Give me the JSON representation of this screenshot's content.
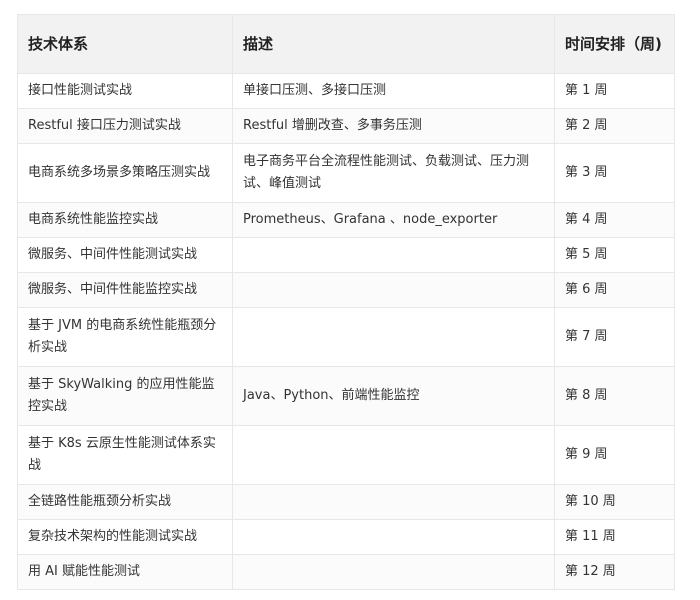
{
  "table": {
    "headers": {
      "col1": "技术体系",
      "col2": "描述",
      "col3": "时间安排（周)"
    },
    "rows": [
      {
        "system": "接口性能测试实战",
        "desc": "单接口压测、多接口压测",
        "week": "第 1 周"
      },
      {
        "system": "Restful 接口压力测试实战",
        "desc": "Restful 增删改查、多事务压测",
        "week": "第 2 周"
      },
      {
        "system": "电商系统多场景多策略压测实战",
        "desc": "电子商务平台全流程性能测试、负载测试、压力测试、峰值测试",
        "week": "第 3 周"
      },
      {
        "system": "电商系统性能监控实战",
        "desc": "Prometheus、Grafana 、node_exporter",
        "week": "第 4 周"
      },
      {
        "system": "微服务、中间件性能测试实战",
        "desc": "",
        "week": "第 5 周"
      },
      {
        "system": "微服务、中间件性能监控实战",
        "desc": "",
        "week": "第 6 周"
      },
      {
        "system": "基于 JVM 的电商系统性能瓶颈分析实战",
        "desc": "",
        "week": "第 7 周"
      },
      {
        "system": "基于 SkyWalking 的应用性能监控实战",
        "desc": "Java、Python、前端性能监控",
        "week": "第 8 周"
      },
      {
        "system": "基于 K8s 云原生性能测试体系实战",
        "desc": "",
        "week": "第 9 周"
      },
      {
        "system": "全链路性能瓶颈分析实战",
        "desc": "",
        "week": "第 10 周"
      },
      {
        "system": "复杂技术架构的性能测试实战",
        "desc": "",
        "week": "第 11 周"
      },
      {
        "system": "用 AI 赋能性能测试",
        "desc": "",
        "week": "第 12 周"
      }
    ]
  }
}
